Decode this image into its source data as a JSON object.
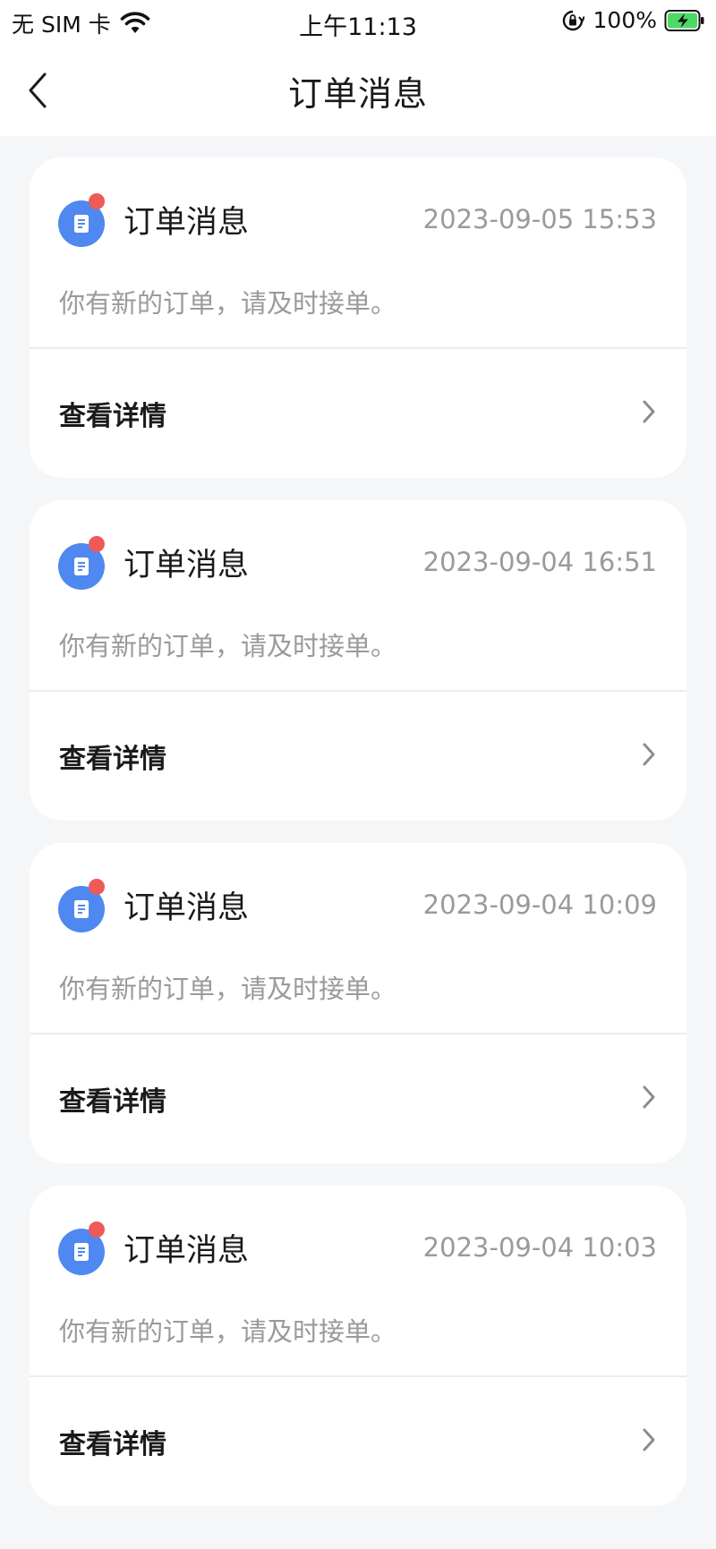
{
  "status_bar": {
    "carrier": "无 SIM 卡",
    "time": "上午11:13",
    "battery": "100%"
  },
  "nav": {
    "title": "订单消息"
  },
  "messages": [
    {
      "title": "订单消息",
      "time": "2023-09-05 15:53",
      "content": "你有新的订单，请及时接单。",
      "action_label": "查看详情"
    },
    {
      "title": "订单消息",
      "time": "2023-09-04 16:51",
      "content": "你有新的订单，请及时接单。",
      "action_label": "查看详情"
    },
    {
      "title": "订单消息",
      "time": "2023-09-04 10:09",
      "content": "你有新的订单，请及时接单。",
      "action_label": "查看详情"
    },
    {
      "title": "订单消息",
      "time": "2023-09-04 10:03",
      "content": "你有新的订单，请及时接单。",
      "action_label": "查看详情"
    }
  ],
  "colors": {
    "accent": "#4f88f0",
    "badge": "#ee5a55",
    "battery": "#4cd964"
  }
}
